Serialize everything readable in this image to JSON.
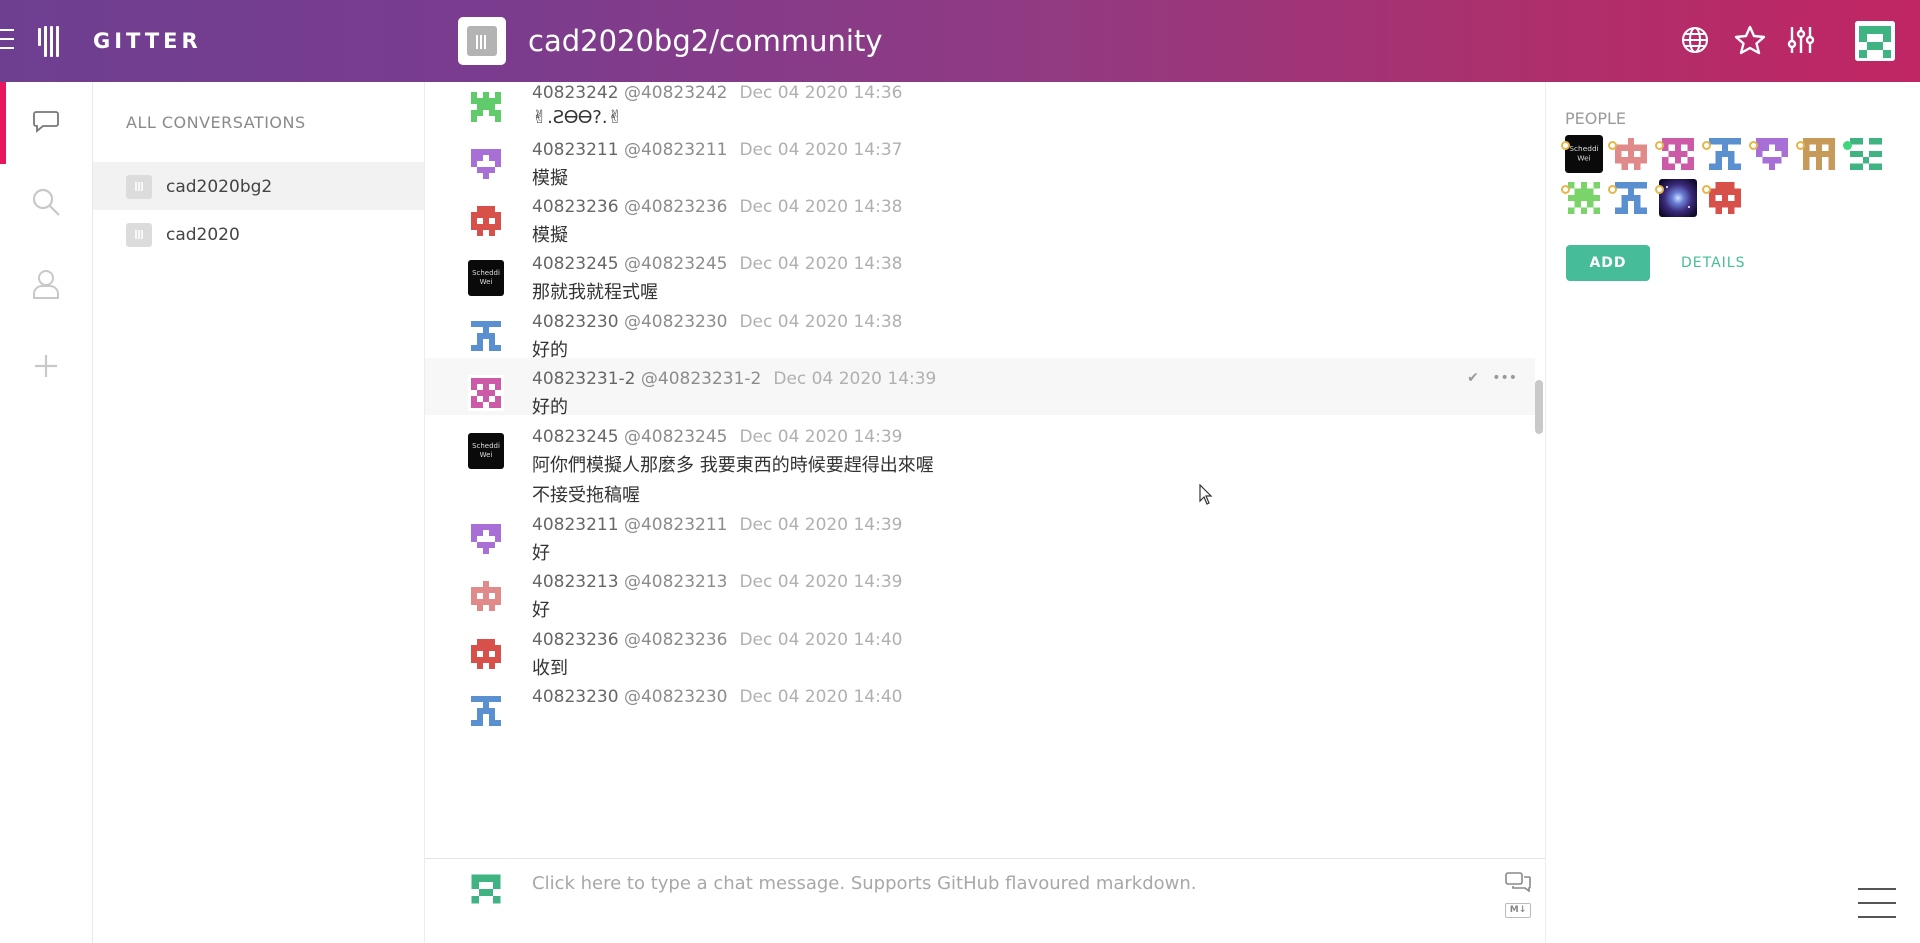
{
  "header": {
    "logo_text": "GITTER",
    "room_title": "cad2020bg2/community"
  },
  "conversations": {
    "heading": "ALL CONVERSATIONS",
    "items": [
      {
        "label": "cad2020bg2"
      },
      {
        "label": "cad2020"
      }
    ]
  },
  "messages": [
    {
      "user": "40823242",
      "handle": "@40823242",
      "time": "Dec 04 2020 14:36",
      "text": "✌.ƧᎾᎾ?.✌",
      "avatar": "green"
    },
    {
      "user": "40823211",
      "handle": "@40823211",
      "time": "Dec 04 2020 14:37",
      "text": "模擬",
      "avatar": "purple"
    },
    {
      "user": "40823236",
      "handle": "@40823236",
      "time": "Dec 04 2020 14:38",
      "text": "模擬",
      "avatar": "red"
    },
    {
      "user": "40823245",
      "handle": "@40823245",
      "time": "Dec 04 2020 14:38",
      "text": "那就我就程式喔",
      "avatar": "photo"
    },
    {
      "user": "40823230",
      "handle": "@40823230",
      "time": "Dec 04 2020 14:38",
      "text": "好的",
      "avatar": "blue"
    },
    {
      "user": "40823231-2",
      "handle": "@40823231-2",
      "time": "Dec 04 2020 14:39",
      "text": "好的",
      "avatar": "pink"
    },
    {
      "user": "40823245",
      "handle": "@40823245",
      "time": "Dec 04 2020 14:39",
      "text": "阿你們模擬人那麼多 我要東西的時候要趕得出來喔",
      "text2": "不接受拖稿喔",
      "avatar": "photo"
    },
    {
      "user": "40823211",
      "handle": "@40823211",
      "time": "Dec 04 2020 14:39",
      "text": "好",
      "avatar": "purple"
    },
    {
      "user": "40823213",
      "handle": "@40823213",
      "time": "Dec 04 2020 14:39",
      "text": "好",
      "avatar": "lightred"
    },
    {
      "user": "40823236",
      "handle": "@40823236",
      "time": "Dec 04 2020 14:40",
      "text": "收到",
      "avatar": "red"
    },
    {
      "user": "40823230",
      "handle": "@40823230",
      "time": "Dec 04 2020 14:40",
      "text": "",
      "avatar": "blue"
    }
  ],
  "photo_avatar_text": [
    "Scheddi",
    "Wei"
  ],
  "composer": {
    "placeholder": "Click here to type a chat message. Supports GitHub flavoured markdown.",
    "md_label": "M↓"
  },
  "people": {
    "title": "PEOPLE",
    "add_label": "ADD",
    "details_label": "DETAILS"
  },
  "colors": {
    "accent": "#46bc99",
    "header_start": "#6e3f91",
    "header_end": "#c02663",
    "rail_active": "#e8175d"
  }
}
